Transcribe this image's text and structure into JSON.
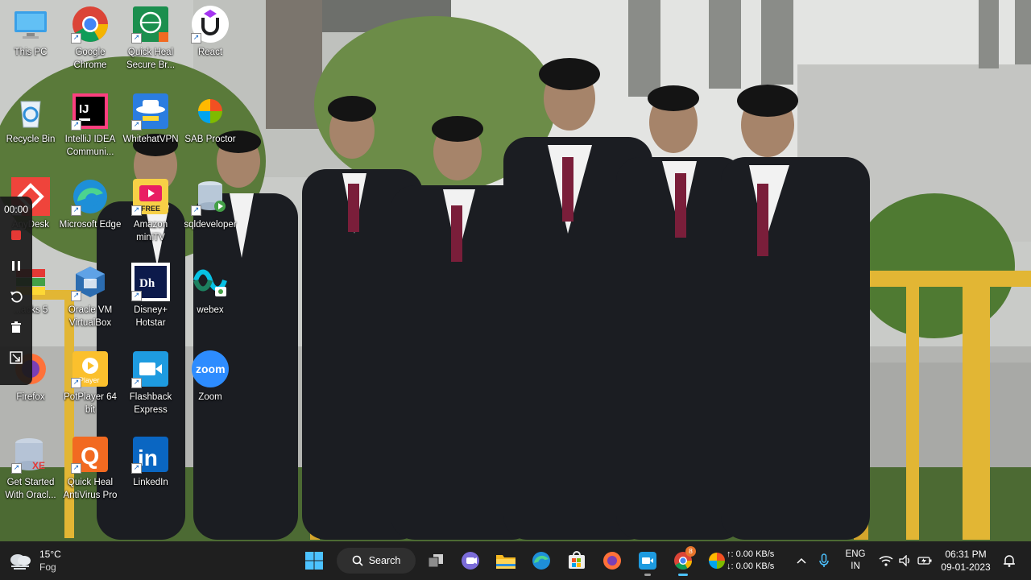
{
  "desktop_icons": [
    {
      "label": "This PC"
    },
    {
      "label": "Google Chrome"
    },
    {
      "label": "Quick Heal Secure Br..."
    },
    {
      "label": "React"
    },
    {
      "label": "Recycle Bin"
    },
    {
      "label": "IntelliJ IDEA Communi..."
    },
    {
      "label": "WhitehatVPN"
    },
    {
      "label": "SAB Proctor"
    },
    {
      "label": "AnyDesk"
    },
    {
      "label": "Microsoft Edge"
    },
    {
      "label": "Amazon miniTV"
    },
    {
      "label": "sqldeveloper"
    },
    {
      "label": "...acks 5"
    },
    {
      "label": "Oracle VM VirtualBox"
    },
    {
      "label": "Disney+ Hotstar"
    },
    {
      "label": "webex"
    },
    {
      "label": "Firefox"
    },
    {
      "label": "PotPlayer 64 bit"
    },
    {
      "label": "Flashback Express"
    },
    {
      "label": "Zoom"
    },
    {
      "label": "Get Started With Oracl..."
    },
    {
      "label": "Quick Heal AntiVirus Pro"
    },
    {
      "label": "LinkedIn"
    }
  ],
  "icon_glyphs": {
    "intellij": "IJ",
    "zoom": "zoom",
    "linkedin": "in",
    "quickheal": "Q",
    "hotstar": "Dh",
    "potplayer": "Player",
    "minitv": "FREE",
    "xe": "XE"
  },
  "recorder": {
    "time": "00:00"
  },
  "taskbar": {
    "weather_temp": "15°C",
    "weather_desc": "Fog",
    "search_label": "Search",
    "net_up": "↑: 0.00 KB/s",
    "net_down": "↓: 0.00 KB/s",
    "lang_top": "ENG",
    "lang_bottom": "IN",
    "time": "06:31 PM",
    "date": "09-01-2023",
    "chrome_badge": "8"
  },
  "colors": {
    "taskbar_bg": "#1f1f1f",
    "accent_blue": "#0078d4",
    "recorder_bg": "#191919",
    "record_red": "#e53935"
  }
}
